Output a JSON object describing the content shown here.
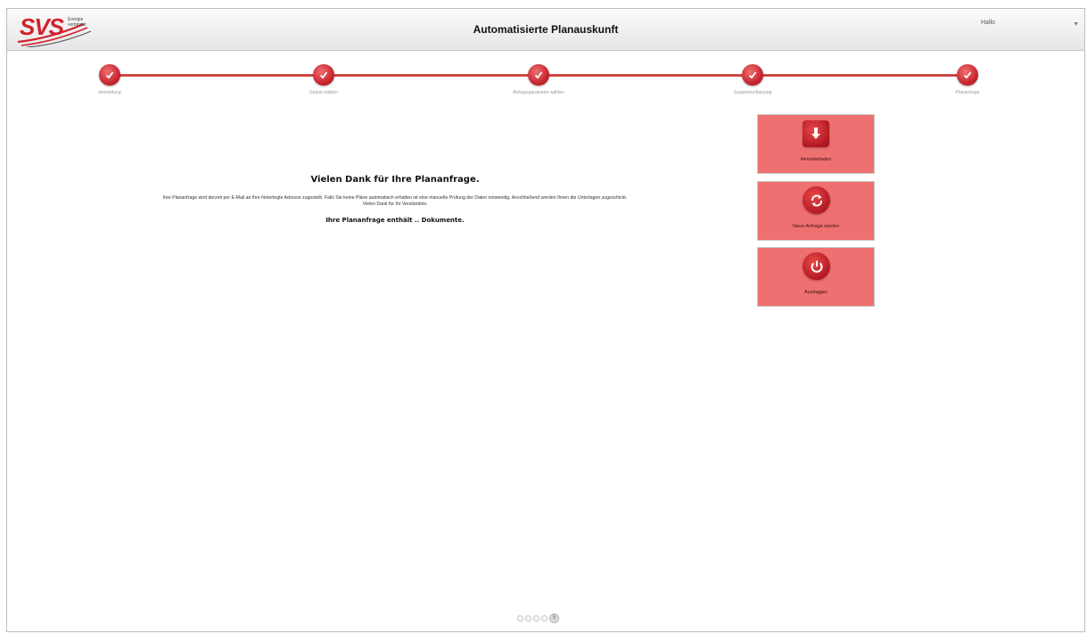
{
  "header": {
    "logo": {
      "brand": "SVS",
      "tagline": "Energie verbindet"
    },
    "title": "Automatisierte Planauskunft",
    "user_greeting": "Hallo",
    "user_menu_icon": "chevron-down-icon"
  },
  "stepper": {
    "steps": [
      {
        "label": "Anmeldung",
        "status": "completed"
      },
      {
        "label": "Gebiet wählen",
        "status": "completed"
      },
      {
        "label": "Anfrageparameter wählen",
        "status": "completed"
      },
      {
        "label": "Zusammenfassung",
        "status": "completed"
      },
      {
        "label": "Plananfrage",
        "status": "completed"
      }
    ]
  },
  "message": {
    "title": "Vielen Dank für Ihre Plananfrage.",
    "body_line1": "Ihre Plananfrage wird derzeit per E-Mail an Ihre hinterlegte Adresse zugestellt. Falls Sie keine Pläne automatisch erhalten ist eine manuelle Prüfung der Daten notwendig. Anschließend werden Ihnen die Unterlagen zugeschickt.",
    "body_line2": "Vielen Dank für Ihr Verständnis.",
    "documents_note": "Ihre Plananfrage enthält .. Dokumente."
  },
  "actions": [
    {
      "label": "Herunterladen",
      "icon": "download-icon"
    },
    {
      "label": "Neue Anfrage starten",
      "icon": "refresh-icon"
    },
    {
      "label": "Ausloggen",
      "icon": "power-icon"
    }
  ],
  "pager": {
    "active_label": "5"
  },
  "colors": {
    "accent": "#c4212b",
    "button_bg": "#ef7070",
    "brand_red": "#d3212c"
  }
}
